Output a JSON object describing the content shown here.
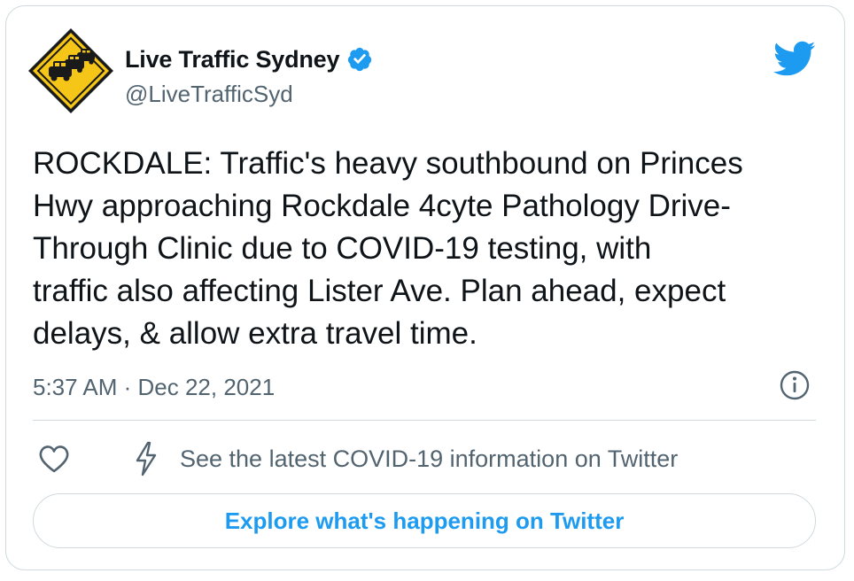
{
  "account": {
    "display_name": "Live Traffic Sydney",
    "handle": "@LiveTrafficSyd",
    "avatar_icon": "traffic-sign-avatar",
    "verified_icon": "verified-badge-icon",
    "verified_color": "#1d9bf0"
  },
  "brand": {
    "logo_icon": "twitter-bird-icon",
    "color": "#1d9bf0"
  },
  "tweet": {
    "lines": [
      "ROCKDALE: Traffic's heavy southbound on Princes",
      "Hwy approaching Rockdale 4cyte Pathology Drive-",
      "Through Clinic due to COVID-19 testing, with",
      "traffic also affecting Lister Ave. Plan ahead, expect",
      "delays, & allow extra travel time."
    ],
    "timestamp": "5:37 AM · Dec 22, 2021"
  },
  "actions": {
    "like_icon": "heart-icon",
    "info_icon": "info-icon",
    "covid_icon": "lightning-bolt-icon",
    "covid_label": "See the latest COVID-19 information on Twitter",
    "explore_label": "Explore what's happening on Twitter"
  }
}
